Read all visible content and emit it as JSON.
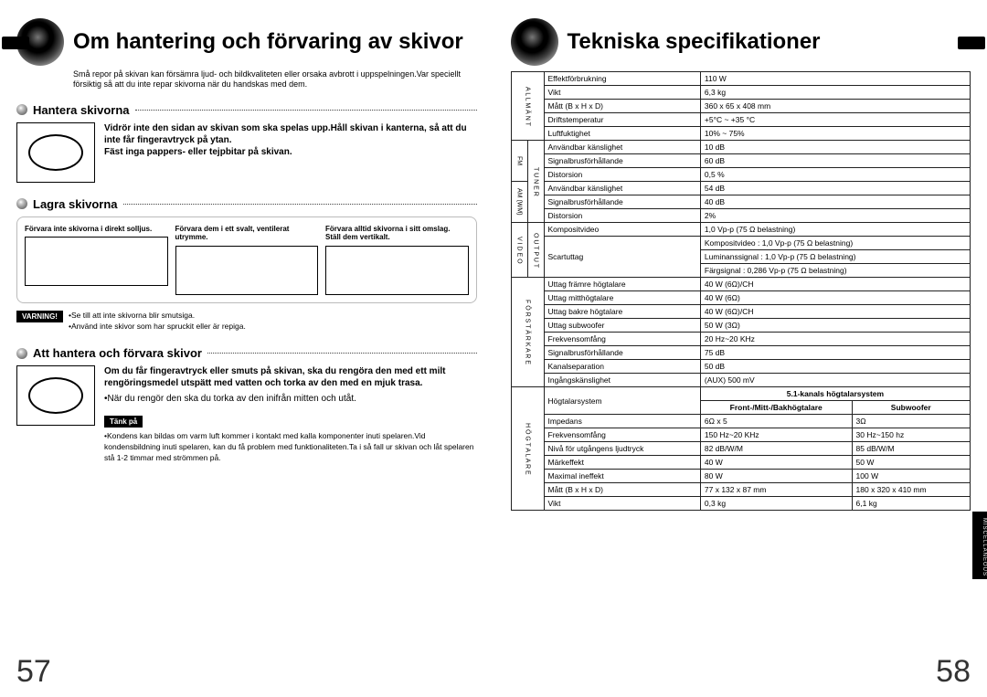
{
  "left": {
    "title": "Om hantering och förvaring av skivor",
    "intro": "Små repor på skivan kan försämra ljud- och bildkvaliteten eller orsaka avbrott i uppspelningen.Var speciellt försiktig så att du inte repar skivorna när du handskas med dem.",
    "s1h": "Hantera skivorna",
    "s1p": "Vidrör inte den sidan av skivan som ska spelas upp.Håll skivan i kanterna, så att du inte får fingeravtryck på ytan.\nFäst inga pappers- eller tejpbitar på skivan.",
    "s2h": "Lagra skivorna",
    "store1": "Förvara inte skivorna i direkt solljus.",
    "store2": "Förvara dem i ett svalt, ventilerat utrymme.",
    "store3": "Förvara alltid skivorna i sitt omslag.\nStäll dem vertikalt.",
    "warnLabel": "VARNING!",
    "warn1": "•Se till att inte skivorna blir smutsiga.",
    "warn2": "•Använd inte skivor som har spruckit eller är repiga.",
    "s3h": "Att hantera och förvara skivor",
    "s3p": "Om du får fingeravtryck eller smuts på skivan, ska du rengöra den med ett milt rengöringsmedel utspätt med vatten och torka av den med en mjuk trasa.",
    "s3p2": "•När du rengör den ska du torka av den inifrån mitten och utåt.",
    "think": "Tänk på",
    "thinkp": "•Kondens kan bildas om varm luft kommer i kontakt med kalla komponenter inuti spelaren.Vid kondensbildning inuti spelaren, kan du få problem med funktionaliteten.Ta i så fall ur skivan och låt spelaren stå 1-2 timmar med strömmen på.",
    "pnum": "57"
  },
  "right": {
    "title": "Tekniska specifikationer",
    "sidetab": "MISCELLANEOUS",
    "pnum": "58",
    "cats": {
      "g": "A L L M Ä N T",
      "fm": "FM",
      "am": "AM (WM)",
      "tuner": "T U N E R",
      "vid": "V I D E O",
      "out": "O U T P U T",
      "amp": "F Ö R S T Ä R K A R E",
      "spk": "H Ö G T A L A R E"
    },
    "rows": {
      "g": [
        [
          "Effektförbrukning",
          "110 W"
        ],
        [
          "Vikt",
          "6,3 kg"
        ],
        [
          "Mått (B x H x D)",
          "360 x 65 x 408 mm"
        ],
        [
          "Driftstemperatur",
          "+5°C ~ +35 °C"
        ],
        [
          "Luftfuktighet",
          "10% ~ 75%"
        ]
      ],
      "fm": [
        [
          "Användbar känslighet",
          "10 dB"
        ],
        [
          "Signalbrusförhållande",
          "60 dB"
        ],
        [
          "Distorsion",
          "0,5 %"
        ]
      ],
      "am": [
        [
          "Användbar känslighet",
          "54 dB"
        ],
        [
          "Signalbrusförhållande",
          "40 dB"
        ],
        [
          "Distorsion",
          "2%"
        ]
      ],
      "vid": [
        [
          "Kompositvideo",
          "1,0 Vp-p (75 Ω belastning)"
        ],
        [
          "Scartuttag",
          "Kompositvideo : 1,0 Vp-p (75 Ω belastning)"
        ],
        [
          "",
          "Luminanssignal : 1,0 Vp-p (75 Ω belastning)"
        ],
        [
          "",
          "Färgsignal : 0,286 Vp-p (75 Ω belastning)"
        ]
      ],
      "amp": [
        [
          "Uttag främre högtalare",
          "40 W (6Ω)/CH"
        ],
        [
          "Uttag mitthögtalare",
          "40 W (6Ω)"
        ],
        [
          "Uttag bakre högtalare",
          "40 W (6Ω)/CH"
        ],
        [
          "Uttag subwoofer",
          "50 W (3Ω)"
        ],
        [
          "Frekvensomfång",
          "20 Hz~20 KHz"
        ],
        [
          "Signalbrusförhållande",
          "75 dB"
        ],
        [
          "Kanalseparation",
          "50 dB"
        ],
        [
          "Ingångskänslighet",
          "(AUX) 500 mV"
        ]
      ],
      "spk_head": [
        "Högtalarsystem",
        "5.1-kanals högtalarsystem"
      ],
      "spk_sub": [
        "",
        "Front-/Mitt-/Bakhögtalare",
        "Subwoofer"
      ],
      "spk": [
        [
          "Impedans",
          "6Ω x 5",
          "3Ω"
        ],
        [
          "Frekvensomfång",
          "150 Hz~20 KHz",
          "30 Hz~150 hz"
        ],
        [
          "Nivå för utgångens ljudtryck",
          "82 dB/W/M",
          "85 dB/W/M"
        ],
        [
          "Märkeffekt",
          "40 W",
          "50 W"
        ],
        [
          "Maximal ineffekt",
          "80 W",
          "100 W"
        ],
        [
          "Mått  (B x H x D)",
          "77 x 132 x 87 mm",
          "180 x 320 x 410 mm"
        ],
        [
          "Vikt",
          "0,3 kg",
          "6,1 kg"
        ]
      ]
    }
  }
}
